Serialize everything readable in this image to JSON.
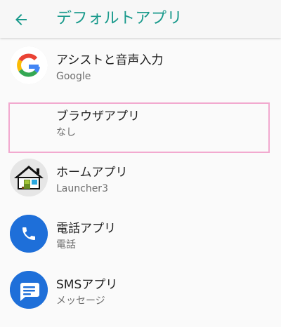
{
  "appbar": {
    "title": "デフォルトアプリ",
    "back_icon": "arrow-left-icon"
  },
  "colors": {
    "accent": "#1a9a8c",
    "highlight_border": "#f2a9cf",
    "phone_blue": "#1e6fd9",
    "messages_blue": "#1e6fd9"
  },
  "items": [
    {
      "title": "アシストと音声入力",
      "subtitle": "Google",
      "icon": "google-g-icon"
    },
    {
      "title": "ブラウザアプリ",
      "subtitle": "なし",
      "icon": ""
    },
    {
      "title": "ホームアプリ",
      "subtitle": "Launcher3",
      "icon": "home-launcher-icon"
    },
    {
      "title": "電話アプリ",
      "subtitle": "電話",
      "icon": "phone-icon"
    },
    {
      "title": "SMSアプリ",
      "subtitle": "メッセージ",
      "icon": "message-icon"
    }
  ]
}
